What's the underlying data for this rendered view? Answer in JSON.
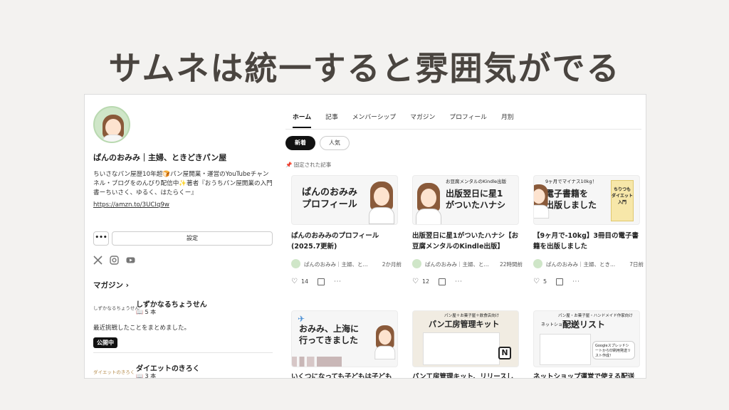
{
  "headline": "サムネは統一すると雰囲気がでる",
  "profile": {
    "name": "ぱんのおみみ｜主婦、ときどきパン屋",
    "bio": "ちいさなパン屋歴10年超🍞パン屋開業・運営のYouTubeチャンネル・ブログをのんびり配信中✨著者『おうちパン屋開業の入門書ーちいさく、ゆるく、はたらくー』",
    "link": "https://amzn.to/3UCIq9w",
    "more_label": "•••",
    "settings_label": "設定"
  },
  "magazines": {
    "heading": "マガジン",
    "items": [
      {
        "logo": "しずかなるちょうせん",
        "title": "しずかなるちょうせん",
        "count": "5 本",
        "desc": "最近挑戦したことをまとめました。",
        "badge": "公開中"
      },
      {
        "logo": "ダイエットのきろく",
        "title": "ダイエットのきろく",
        "count": "3 本"
      }
    ]
  },
  "tabs": [
    "ホーム",
    "記事",
    "メンバーシップ",
    "マガジン",
    "プロフィール",
    "月別"
  ],
  "filters": {
    "new": "新着",
    "popular": "人気"
  },
  "pinned_label": "固定された記事",
  "articles": [
    {
      "thumb": "ぱんのおみみのプロフィール",
      "thumb_line1": "ぱんのおみみ",
      "thumb_line2": "プロフィール",
      "title": "ぱんのおみみのプロフィール(2025.7更新)",
      "author": "ぱんのおみみ｜主婦、と...",
      "time": "2か月前",
      "likes": "14"
    },
    {
      "thumb_top": "お豆腐メンタルのKindle出版",
      "thumb_line1": "出版翌日に星1",
      "thumb_line2": "がついたハナシ",
      "title": "出版翌日に星1がついたハナシ【お豆腐メンタルのKindle出版】",
      "author": "ぱんのおみみ｜主婦、と...",
      "time": "22時間前",
      "likes": "12"
    },
    {
      "thumb_top": "9ヶ月でマイナス10kg！",
      "thumb_line1": "電子書籍を",
      "thumb_line2": "出版しました",
      "cover": "ちりつもダイエット入門",
      "title": "【9ヶ月で-10kg】3冊目の電子書籍を出版しました",
      "author": "ぱんのおみみ｜主婦、とき...",
      "time": "7日前",
      "likes": "5"
    },
    {
      "thumb_line1": "おみみ、上海に",
      "thumb_line2": "行ってきました",
      "title": "いくつになっても子どもは子ども"
    },
    {
      "thumb_top": "パン屋＋お菓子屋＋飲食店向け",
      "thumb_line1": "パン工房管理キット",
      "title": "パン工房管理キット、リリースし"
    },
    {
      "thumb_top": "パン屋・お菓子屋・ハンドメイド作家向け",
      "thumb_line1": "配送リスト",
      "thumb_sub": "ネットショップ用",
      "thumb_note": "Googleスプレッドシートから印刷用発送リスト作成！",
      "title": "ネットショップ運営で使える配送"
    }
  ]
}
